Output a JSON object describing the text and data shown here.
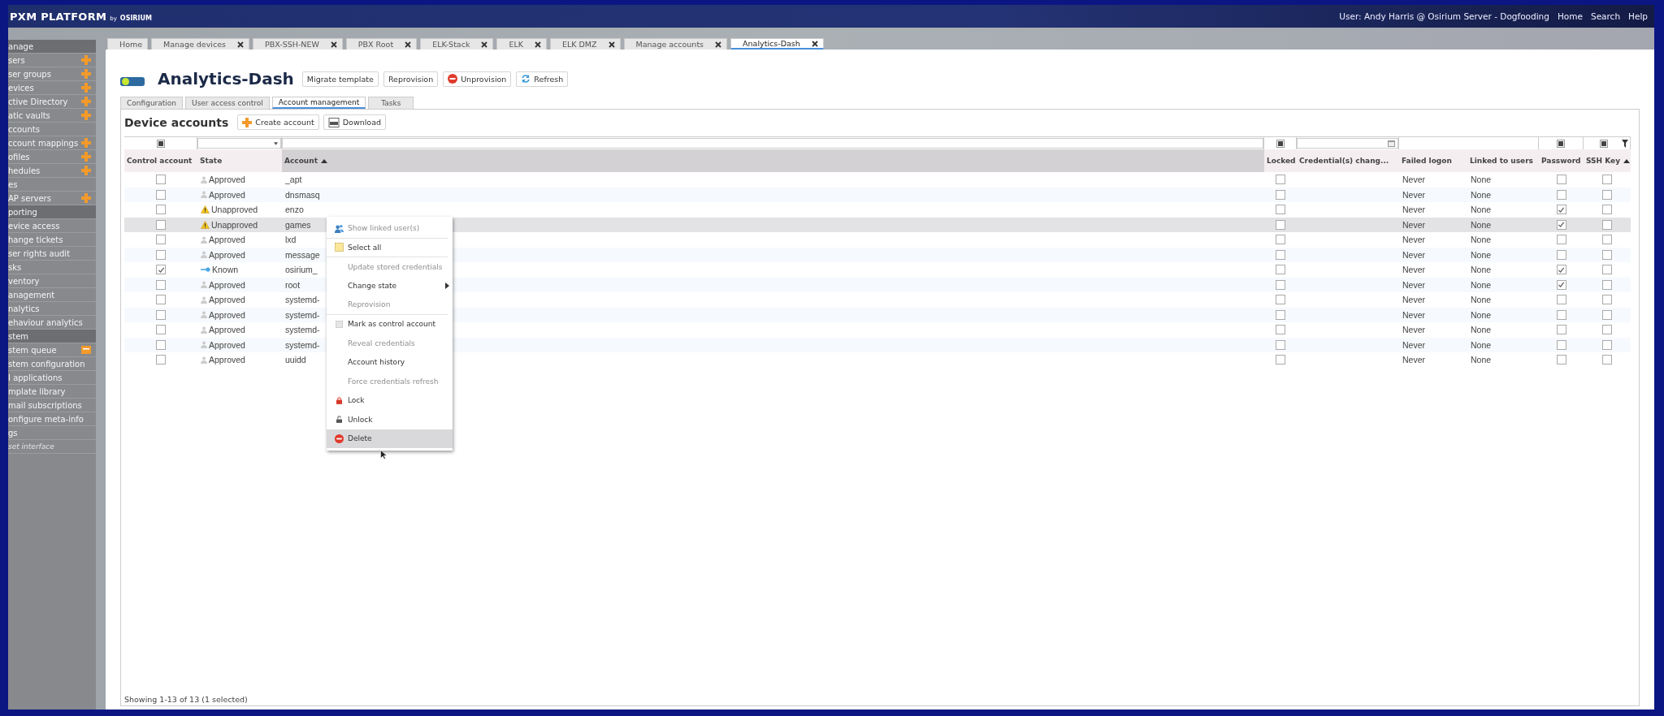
{
  "top_bar": {
    "logo": {
      "name": "PXM PLATFORM",
      "by": "by",
      "brand": "OSIRIUM"
    },
    "user": "User: Andy Harris @ Osirium Server - Dogfooding",
    "links": [
      "Home",
      "Search",
      "Help"
    ]
  },
  "sidebar": {
    "items": [
      {
        "label": "anage",
        "kind": "header"
      },
      {
        "label": "sers",
        "kind": "add_link"
      },
      {
        "label": "ser groups",
        "kind": "add_link"
      },
      {
        "label": "evices",
        "kind": "add_link"
      },
      {
        "label": "ctive Directory",
        "kind": "add_link"
      },
      {
        "label": "atic vaults",
        "kind": "add_link"
      },
      {
        "label": "ccounts",
        "kind": "link"
      },
      {
        "label": "ccount mappings",
        "kind": "add_link"
      },
      {
        "label": "ofiles",
        "kind": "add_link"
      },
      {
        "label": "hedules",
        "kind": "add_link"
      },
      {
        "label": "es",
        "kind": "link"
      },
      {
        "label": "AP servers",
        "kind": "add_link"
      },
      {
        "label": "porting",
        "kind": "header"
      },
      {
        "label": "evice access",
        "kind": "link"
      },
      {
        "label": "hange tickets",
        "kind": "link"
      },
      {
        "label": "ser rights audit",
        "kind": "link"
      },
      {
        "label": "sks",
        "kind": "link"
      },
      {
        "label": "ventory",
        "kind": "link"
      },
      {
        "label": "anagement",
        "kind": "link"
      },
      {
        "label": "nalytics",
        "kind": "link"
      },
      {
        "label": "ehaviour analytics",
        "kind": "link"
      },
      {
        "label": "stem",
        "kind": "header"
      },
      {
        "label": "stem queue",
        "kind": "queue_link"
      },
      {
        "label": "stem configuration",
        "kind": "link"
      },
      {
        "label": "I applications",
        "kind": "link"
      },
      {
        "label": "mplate library",
        "kind": "link"
      },
      {
        "label": "mail subscriptions",
        "kind": "link"
      },
      {
        "label": "onfigure meta-info",
        "kind": "link"
      },
      {
        "label": "gs",
        "kind": "link"
      },
      {
        "label": "set interface",
        "kind": "muted"
      }
    ]
  },
  "tabs": [
    {
      "label": "Home",
      "closable": false,
      "selected": false
    },
    {
      "label": "Manage devices",
      "closable": true,
      "selected": false
    },
    {
      "label": "PBX-SSH-NEW",
      "closable": true,
      "selected": false
    },
    {
      "label": "PBX Root",
      "closable": true,
      "selected": false
    },
    {
      "label": "ELK-Stack",
      "closable": true,
      "selected": false
    },
    {
      "label": "ELK",
      "closable": true,
      "selected": false
    },
    {
      "label": "ELK DMZ",
      "closable": true,
      "selected": false
    },
    {
      "label": "Manage accounts",
      "closable": true,
      "selected": false
    },
    {
      "label": "Analytics-Dash",
      "closable": true,
      "selected": true
    }
  ],
  "device": {
    "title": "Analytics-Dash",
    "actions": [
      {
        "label": "Migrate template",
        "kind": "plain"
      },
      {
        "label": "Reprovision",
        "kind": "plain"
      },
      {
        "label": "Unprovision",
        "kind": "stop"
      },
      {
        "label": "Refresh",
        "kind": "refresh"
      }
    ]
  },
  "sub_tabs": [
    {
      "label": "Configuration",
      "selected": false
    },
    {
      "label": "User access control",
      "selected": false
    },
    {
      "label": "Account management",
      "selected": true
    },
    {
      "label": "Tasks",
      "selected": false
    }
  ],
  "section": {
    "title": "Device accounts",
    "actions": [
      {
        "label": "Create account",
        "kind": "add"
      },
      {
        "label": "Download",
        "kind": "csv"
      }
    ]
  },
  "table": {
    "filters": [
      {
        "kind": "tristate",
        "indeterminate": true
      },
      {
        "kind": "select"
      },
      {
        "kind": "text"
      },
      {
        "kind": "tristate",
        "indeterminate": true
      },
      {
        "kind": "date"
      },
      {
        "kind": "blank"
      },
      {
        "kind": "blank"
      },
      {
        "kind": "tristate",
        "indeterminate": true
      },
      {
        "kind": "tristate",
        "indeterminate": true
      }
    ],
    "columns": [
      "Control account",
      "State",
      "Account",
      "Locked",
      "Credential(s) chang...",
      "Failed logon",
      "Linked to users",
      "Password",
      "SSH Key"
    ],
    "rows": [
      {
        "control": false,
        "kind": "approved",
        "state": "Approved",
        "account": "_apt",
        "locked": false,
        "failed_logon": "Never",
        "linked": "None",
        "password": false,
        "ssh_key": false,
        "selected": false
      },
      {
        "control": false,
        "kind": "approved",
        "state": "Approved",
        "account": "dnsmasq",
        "locked": false,
        "failed_logon": "Never",
        "linked": "None",
        "password": false,
        "ssh_key": false,
        "selected": false
      },
      {
        "control": false,
        "kind": "unapproved",
        "state": "Unapproved",
        "account": "enzo",
        "locked": false,
        "failed_logon": "Never",
        "linked": "None",
        "password": true,
        "ssh_key": false,
        "selected": false
      },
      {
        "control": false,
        "kind": "unapproved",
        "state": "Unapproved",
        "account": "games",
        "locked": false,
        "failed_logon": "Never",
        "linked": "None",
        "password": true,
        "ssh_key": false,
        "selected": true
      },
      {
        "control": false,
        "kind": "approved",
        "state": "Approved",
        "account": "lxd",
        "locked": false,
        "failed_logon": "Never",
        "linked": "None",
        "password": false,
        "ssh_key": false,
        "selected": false
      },
      {
        "control": false,
        "kind": "approved",
        "state": "Approved",
        "account": "message",
        "locked": false,
        "failed_logon": "Never",
        "linked": "None",
        "password": false,
        "ssh_key": false,
        "selected": false
      },
      {
        "control": true,
        "kind": "known",
        "state": "Known",
        "account": "osirium_",
        "locked": false,
        "failed_logon": "Never",
        "linked": "None",
        "password": true,
        "ssh_key": false,
        "selected": false
      },
      {
        "control": false,
        "kind": "approved",
        "state": "Approved",
        "account": "root",
        "locked": false,
        "failed_logon": "Never",
        "linked": "None",
        "password": true,
        "ssh_key": false,
        "selected": false
      },
      {
        "control": false,
        "kind": "approved",
        "state": "Approved",
        "account": "systemd-",
        "locked": false,
        "failed_logon": "Never",
        "linked": "None",
        "password": false,
        "ssh_key": false,
        "selected": false
      },
      {
        "control": false,
        "kind": "approved",
        "state": "Approved",
        "account": "systemd-",
        "locked": false,
        "failed_logon": "Never",
        "linked": "None",
        "password": false,
        "ssh_key": false,
        "selected": false
      },
      {
        "control": false,
        "kind": "approved",
        "state": "Approved",
        "account": "systemd-",
        "locked": false,
        "failed_logon": "Never",
        "linked": "None",
        "password": false,
        "ssh_key": false,
        "selected": false
      },
      {
        "control": false,
        "kind": "approved",
        "state": "Approved",
        "account": "systemd-",
        "locked": false,
        "failed_logon": "Never",
        "linked": "None",
        "password": false,
        "ssh_key": false,
        "selected": false
      },
      {
        "control": false,
        "kind": "approved",
        "state": "Approved",
        "account": "uuidd",
        "locked": false,
        "failed_logon": "Never",
        "linked": "None",
        "password": false,
        "ssh_key": false,
        "selected": false
      }
    ],
    "status": "Showing 1-13 of 13 (1 selected)"
  },
  "context_menu": {
    "items": [
      {
        "label": "Show linked user(s)",
        "kind": "users",
        "disabled": true,
        "highlighted": false,
        "submenu": false,
        "divider": true
      },
      {
        "label": "Select all",
        "kind": "select",
        "disabled": false,
        "highlighted": false,
        "submenu": false,
        "divider": true
      },
      {
        "label": "Update stored credentials",
        "kind": "plain",
        "disabled": true,
        "highlighted": false,
        "submenu": false,
        "divider": false
      },
      {
        "label": "Change state",
        "kind": "plain",
        "disabled": false,
        "highlighted": false,
        "submenu": true,
        "divider": false
      },
      {
        "label": "Reprovision",
        "kind": "plain",
        "disabled": true,
        "highlighted": false,
        "submenu": false,
        "divider": true
      },
      {
        "label": "Mark as control account",
        "kind": "checkbox",
        "disabled": false,
        "highlighted": false,
        "submenu": false,
        "divider": false
      },
      {
        "label": "Reveal credentials",
        "kind": "plain",
        "disabled": true,
        "highlighted": false,
        "submenu": false,
        "divider": false
      },
      {
        "label": "Account history",
        "kind": "plain",
        "disabled": false,
        "highlighted": false,
        "submenu": false,
        "divider": false
      },
      {
        "label": "Force credentials refresh",
        "kind": "plain",
        "disabled": true,
        "highlighted": false,
        "submenu": false,
        "divider": false
      },
      {
        "label": "Lock",
        "kind": "lock",
        "disabled": false,
        "highlighted": false,
        "submenu": false,
        "divider": false
      },
      {
        "label": "Unlock",
        "kind": "unlock",
        "disabled": false,
        "highlighted": false,
        "submenu": false,
        "divider": false
      },
      {
        "label": "Delete",
        "kind": "delete",
        "disabled": false,
        "highlighted": true,
        "submenu": false,
        "divider": false
      }
    ]
  }
}
